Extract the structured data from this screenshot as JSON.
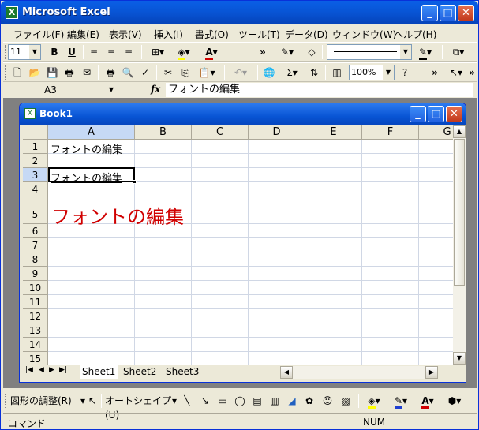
{
  "window": {
    "title": "Microsoft Excel"
  },
  "menu": [
    "ファイル(F)",
    "編集(E)",
    "表示(V)",
    "挿入(I)",
    "書式(O)",
    "ツール(T)",
    "データ(D)",
    "ウィンドウ(W)",
    "ヘルプ(H)"
  ],
  "format_toolbar": {
    "font_size": "11",
    "bold": "B",
    "underline": "U"
  },
  "std_toolbar": {
    "zoom": "100%"
  },
  "formula_bar": {
    "name_box": "A3",
    "fx": "fx",
    "value": "フォントの編集"
  },
  "workbook": {
    "title": "Book1",
    "columns": [
      "A",
      "B",
      "C",
      "D",
      "E",
      "F",
      "G"
    ],
    "rows": [
      "1",
      "2",
      "3",
      "4",
      "5",
      "6",
      "7",
      "8",
      "9",
      "10",
      "11",
      "12",
      "13",
      "14",
      "15"
    ],
    "cells": {
      "A1": "フォントの編集",
      "A3": "フォントの編集",
      "A5": "フォントの編集"
    },
    "sheets": [
      "Sheet1",
      "Sheet2",
      "Sheet3"
    ]
  },
  "draw_toolbar": {
    "adjust": "図形の調整(R)",
    "autoshape": "オートシェイプ(U)"
  },
  "status": {
    "left": "コマンド",
    "num": "NUM"
  },
  "colors": {
    "title_blue": "#0854d4",
    "red_text": "#d00000",
    "selection": "#c6d9f5"
  }
}
